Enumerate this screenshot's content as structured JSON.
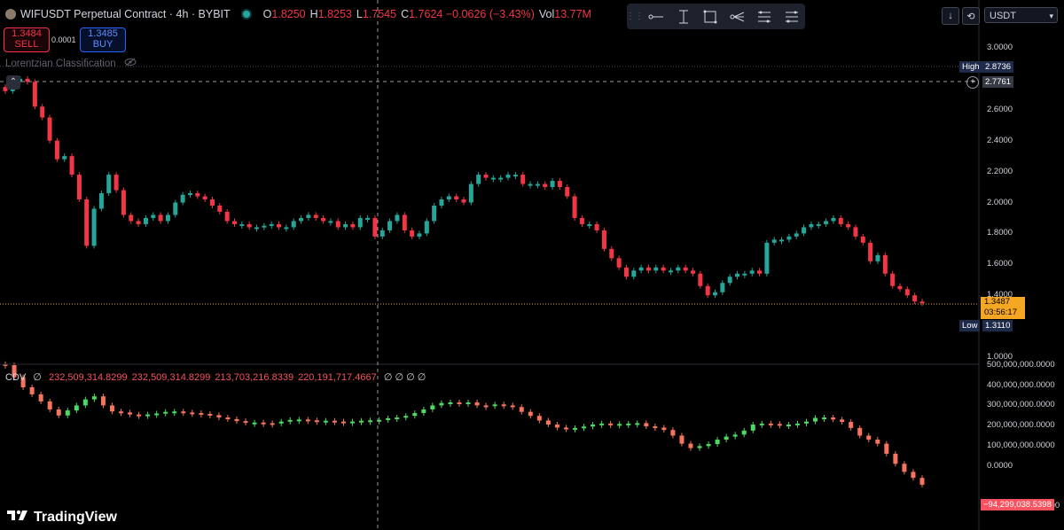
{
  "header": {
    "symbol_title": "WIFUSDT Perpetual Contract · 4h · BYBIT",
    "ohlc": [
      {
        "k": "O",
        "v": "1.8250"
      },
      {
        "k": "H",
        "v": "1.8253"
      },
      {
        "k": "L",
        "v": "1.7545"
      },
      {
        "k": "C",
        "v": "1.7624 −0.0626 (−3.43%)"
      }
    ],
    "vol_label": "Vol",
    "vol_value": "13.77M"
  },
  "trade": {
    "sell_price": "1.3484",
    "sell_label": "SELL",
    "spread": "0.0001",
    "buy_price": "1.3485",
    "buy_label": "BUY"
  },
  "toolbar": {
    "icons": [
      "drag-handle-icon",
      "horizontal-ray-icon",
      "vertical-line-icon",
      "rectangle-icon",
      "pitchfork-icon",
      "fib-levels-icon",
      "long-position-icon"
    ]
  },
  "top_right": {
    "scroll_down_label": "↓",
    "sync_label": "⟲",
    "currency": "USDT"
  },
  "indicator": {
    "name": "Lorentzian Classification"
  },
  "cdv": {
    "name": "CDV",
    "zero": "∅",
    "values": [
      "232,509,314.8299",
      "232,509,314.8299",
      "213,703,216.8339",
      "220,191,717.4667"
    ],
    "trailing": "∅ ∅ ∅ ∅"
  },
  "price_axis": {
    "ticks": [
      "3.0000",
      "2.6000",
      "2.4000",
      "2.2000",
      "2.0000",
      "1.8000",
      "1.6000",
      "1.4000",
      "1.0000"
    ],
    "high_label": "High",
    "high_value": "2.8736",
    "crosshair_value": "2.7761",
    "current_price": "1.3487",
    "countdown": "03:56:17",
    "low_label": "Low",
    "low_value": "1.3110"
  },
  "cdv_axis": {
    "ticks": [
      "500,000,000.0000",
      "400,000,000.0000",
      "300,000,000.0000",
      "200,000,000.0000",
      "100,000,000.0000",
      "0.0000",
      "−200,000,000.0000"
    ],
    "last_value": "−94,299,038.5398"
  },
  "brand": {
    "logo_text": "TradingView"
  },
  "colors": {
    "up": "#26a69a",
    "down": "#f23645",
    "cdv_up": "#4cd964",
    "cdv_down": "#f7755f",
    "price_badge": "#f5a623",
    "low_high_badge": "#1e2b4a"
  },
  "chart_data": {
    "type": "candlestick",
    "price_close_series": [
      2.72,
      2.78,
      2.8,
      2.78,
      2.62,
      2.55,
      2.4,
      2.28,
      2.3,
      2.18,
      2.02,
      1.72,
      1.96,
      2.06,
      2.18,
      2.08,
      1.92,
      1.88,
      1.86,
      1.9,
      1.92,
      1.88,
      1.92,
      2.0,
      2.05,
      2.06,
      2.04,
      2.02,
      1.98,
      1.94,
      1.88,
      1.86,
      1.86,
      1.84,
      1.84,
      1.85,
      1.86,
      1.84,
      1.84,
      1.88,
      1.9,
      1.92,
      1.9,
      1.88,
      1.88,
      1.84,
      1.86,
      1.84,
      1.9,
      1.9,
      1.78,
      1.82,
      1.88,
      1.92,
      1.82,
      1.78,
      1.8,
      1.88,
      1.98,
      2.02,
      2.04,
      2.02,
      2.0,
      2.12,
      2.18,
      2.16,
      2.16,
      2.16,
      2.18,
      2.18,
      2.12,
      2.12,
      2.12,
      2.1,
      2.14,
      2.1,
      2.04,
      1.9,
      1.86,
      1.86,
      1.82,
      1.7,
      1.64,
      1.58,
      1.52,
      1.56,
      1.58,
      1.56,
      1.58,
      1.56,
      1.56,
      1.58,
      1.56,
      1.54,
      1.46,
      1.4,
      1.42,
      1.48,
      1.52,
      1.54,
      1.54,
      1.56,
      1.54,
      1.74,
      1.76,
      1.76,
      1.78,
      1.8,
      1.84,
      1.86,
      1.86,
      1.88,
      1.9,
      1.86,
      1.84,
      1.78,
      1.74,
      1.62,
      1.66,
      1.54,
      1.46,
      1.44,
      1.4,
      1.36,
      1.35
    ],
    "cdv_close_series": [
      500,
      440,
      390,
      355,
      320,
      280,
      250,
      275,
      300,
      330,
      345,
      300,
      270,
      265,
      255,
      250,
      255,
      260,
      268,
      270,
      265,
      262,
      258,
      252,
      240,
      232,
      222,
      215,
      215,
      212,
      210,
      220,
      228,
      230,
      226,
      222,
      224,
      220,
      218,
      220,
      224,
      226,
      228,
      236,
      240,
      248,
      262,
      280,
      300,
      312,
      315,
      312,
      315,
      300,
      298,
      305,
      300,
      292,
      268,
      248,
      225,
      205,
      190,
      185,
      188,
      195,
      205,
      210,
      205,
      208,
      210,
      212,
      196,
      190,
      178,
      150,
      110,
      88,
      98,
      108,
      130,
      145,
      155,
      175,
      205,
      210,
      208,
      200,
      205,
      210,
      220,
      238,
      240,
      230,
      218,
      188,
      150,
      130,
      110,
      60,
      10,
      -30,
      -60,
      -94
    ],
    "price_ylim": [
      1.0,
      3.0
    ],
    "cdv_ylim": [
      -200000000,
      500000000
    ],
    "interval": "4h",
    "exchange": "BYBIT"
  }
}
